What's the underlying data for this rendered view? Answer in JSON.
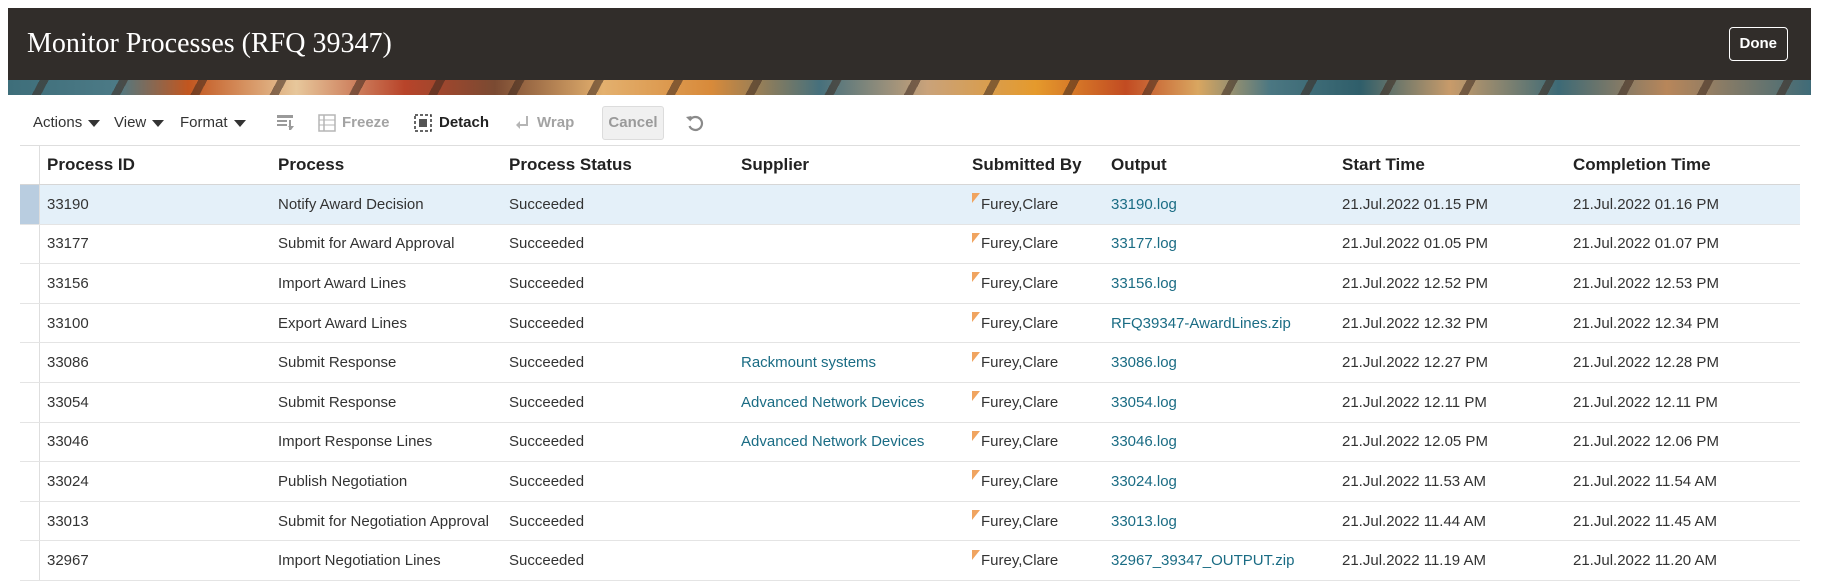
{
  "header": {
    "title": "Monitor Processes (RFQ 39347)",
    "done_label": "Done"
  },
  "toolbar": {
    "actions_label": "Actions",
    "view_label": "View",
    "format_label": "Format",
    "freeze_label": "Freeze",
    "detach_label": "Detach",
    "wrap_label": "Wrap",
    "cancel_label": "Cancel",
    "icons": {
      "freeze": "freeze-icon",
      "detach": "detach-icon",
      "wrap": "wrap-icon",
      "refresh": "refresh-icon",
      "columns": "columns-icon"
    }
  },
  "table": {
    "columns": [
      "Process ID",
      "Process",
      "Process Status",
      "Supplier",
      "Submitted By",
      "Output",
      "Start Time",
      "Completion Time"
    ],
    "rows": [
      {
        "id": "33190",
        "process": "Notify Award Decision",
        "status": "Succeeded",
        "supplier": "",
        "submitted_by": "Furey,Clare",
        "output": "33190.log",
        "start": "21.Jul.2022 01.15 PM",
        "completion": "21.Jul.2022 01.16 PM"
      },
      {
        "id": "33177",
        "process": "Submit for Award Approval",
        "status": "Succeeded",
        "supplier": "",
        "submitted_by": "Furey,Clare",
        "output": "33177.log",
        "start": "21.Jul.2022 01.05 PM",
        "completion": "21.Jul.2022 01.07 PM"
      },
      {
        "id": "33156",
        "process": "Import Award Lines",
        "status": "Succeeded",
        "supplier": "",
        "submitted_by": "Furey,Clare",
        "output": "33156.log",
        "start": "21.Jul.2022 12.52 PM",
        "completion": "21.Jul.2022 12.53 PM"
      },
      {
        "id": "33100",
        "process": "Export Award Lines",
        "status": "Succeeded",
        "supplier": "",
        "submitted_by": "Furey,Clare",
        "output": "RFQ39347-AwardLines.zip",
        "start": "21.Jul.2022 12.32 PM",
        "completion": "21.Jul.2022 12.34 PM"
      },
      {
        "id": "33086",
        "process": "Submit Response",
        "status": "Succeeded",
        "supplier": "Rackmount systems",
        "submitted_by": "Furey,Clare",
        "output": "33086.log",
        "start": "21.Jul.2022 12.27 PM",
        "completion": "21.Jul.2022 12.28 PM"
      },
      {
        "id": "33054",
        "process": "Submit Response",
        "status": "Succeeded",
        "supplier": "Advanced Network Devices",
        "submitted_by": "Furey,Clare",
        "output": "33054.log",
        "start": "21.Jul.2022 12.11 PM",
        "completion": "21.Jul.2022 12.11 PM"
      },
      {
        "id": "33046",
        "process": "Import Response Lines",
        "status": "Succeeded",
        "supplier": "Advanced Network Devices",
        "submitted_by": "Furey,Clare",
        "output": "33046.log",
        "start": "21.Jul.2022 12.05 PM",
        "completion": "21.Jul.2022 12.06 PM"
      },
      {
        "id": "33024",
        "process": "Publish Negotiation",
        "status": "Succeeded",
        "supplier": "",
        "submitted_by": "Furey,Clare",
        "output": "33024.log",
        "start": "21.Jul.2022 11.53 AM",
        "completion": "21.Jul.2022 11.54 AM"
      },
      {
        "id": "33013",
        "process": "Submit for Negotiation Approval",
        "status": "Succeeded",
        "supplier": "",
        "submitted_by": "Furey,Clare",
        "output": "33013.log",
        "start": "21.Jul.2022 11.44 AM",
        "completion": "21.Jul.2022 11.45 AM"
      },
      {
        "id": "32967",
        "process": "Import Negotiation Lines",
        "status": "Succeeded",
        "supplier": "",
        "submitted_by": "Furey,Clare",
        "output": "32967_39347_OUTPUT.zip",
        "start": "21.Jul.2022 11.19 AM",
        "completion": "21.Jul.2022 11.20 AM"
      }
    ]
  },
  "colors": {
    "header_bg": "#312d2a",
    "link": "#1a6c84",
    "selected_row": "#e4f0f9",
    "flag": "#f0a460"
  }
}
